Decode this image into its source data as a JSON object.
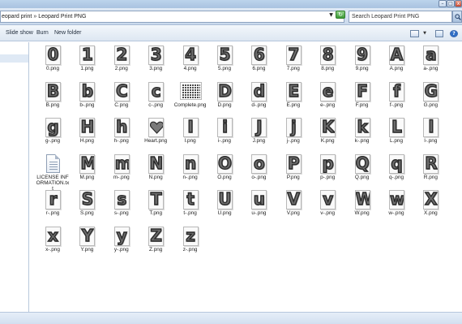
{
  "window": {
    "controls": {
      "minimize": "–",
      "maximize": "□",
      "close": "x"
    }
  },
  "address": {
    "crumbs": [
      "eopard print",
      "Leopard Print PNG"
    ],
    "separator": "»",
    "search_placeholder": "Search Leopard Print PNG"
  },
  "toolbar": {
    "slide_show": "Slide show",
    "burn": "Burn",
    "new_folder": "New folder"
  },
  "files": [
    {
      "name": "0.png",
      "glyph": "0"
    },
    {
      "name": "1.png",
      "glyph": "1"
    },
    {
      "name": "2.png",
      "glyph": "2"
    },
    {
      "name": "3.png",
      "glyph": "3"
    },
    {
      "name": "4.png",
      "glyph": "4"
    },
    {
      "name": "5.png",
      "glyph": "5"
    },
    {
      "name": "6.png",
      "glyph": "6"
    },
    {
      "name": "7.png",
      "glyph": "7"
    },
    {
      "name": "8.png",
      "glyph": "8"
    },
    {
      "name": "9.png",
      "glyph": "9"
    },
    {
      "name": "A.png",
      "glyph": "A"
    },
    {
      "name": "a-.png",
      "glyph": "a"
    },
    {
      "name": "B.png",
      "glyph": "B"
    },
    {
      "name": "b-.png",
      "glyph": "b"
    },
    {
      "name": "C.png",
      "glyph": "C"
    },
    {
      "name": "c-.png",
      "glyph": "c"
    },
    {
      "name": "Complete.png",
      "glyph": ""
    },
    {
      "name": "D.png",
      "glyph": "D"
    },
    {
      "name": "d-.png",
      "glyph": "d"
    },
    {
      "name": "E.png",
      "glyph": "E"
    },
    {
      "name": "e-.png",
      "glyph": "e"
    },
    {
      "name": "F.png",
      "glyph": "F"
    },
    {
      "name": "f-.png",
      "glyph": "f"
    },
    {
      "name": "G.png",
      "glyph": "G"
    },
    {
      "name": "g-.png",
      "glyph": "g"
    },
    {
      "name": "H.png",
      "glyph": "H"
    },
    {
      "name": "h-.png",
      "glyph": "h"
    },
    {
      "name": "Heart.png",
      "glyph": ""
    },
    {
      "name": "I.png",
      "glyph": "I"
    },
    {
      "name": "i-.png",
      "glyph": "i"
    },
    {
      "name": "J.png",
      "glyph": "J"
    },
    {
      "name": "j-.png",
      "glyph": "j"
    },
    {
      "name": "K.png",
      "glyph": "K"
    },
    {
      "name": "k-.png",
      "glyph": "k"
    },
    {
      "name": "L.png",
      "glyph": "L"
    },
    {
      "name": "l-.png",
      "glyph": "l"
    },
    {
      "name": "LICENSE INFORMATION.txt",
      "glyph": ""
    },
    {
      "name": "M.png",
      "glyph": "M"
    },
    {
      "name": "m-.png",
      "glyph": "m"
    },
    {
      "name": "N.png",
      "glyph": "N"
    },
    {
      "name": "n-.png",
      "glyph": "n"
    },
    {
      "name": "O.png",
      "glyph": "O"
    },
    {
      "name": "o-.png",
      "glyph": "o"
    },
    {
      "name": "P.png",
      "glyph": "P"
    },
    {
      "name": "p-.png",
      "glyph": "p"
    },
    {
      "name": "Q.png",
      "glyph": "Q"
    },
    {
      "name": "q-.png",
      "glyph": "q"
    },
    {
      "name": "R.png",
      "glyph": "R"
    },
    {
      "name": "r-.png",
      "glyph": "r"
    },
    {
      "name": "S.png",
      "glyph": "S"
    },
    {
      "name": "s-.png",
      "glyph": "s"
    },
    {
      "name": "T.png",
      "glyph": "T"
    },
    {
      "name": "t-.png",
      "glyph": "t"
    },
    {
      "name": "U.png",
      "glyph": "U"
    },
    {
      "name": "u-.png",
      "glyph": "u"
    },
    {
      "name": "V.png",
      "glyph": "V"
    },
    {
      "name": "v-.png",
      "glyph": "v"
    },
    {
      "name": "W.png",
      "glyph": "W"
    },
    {
      "name": "w-.png",
      "glyph": "w"
    },
    {
      "name": "X.png",
      "glyph": "X"
    },
    {
      "name": "x-.png",
      "glyph": "x"
    },
    {
      "name": "Y.png",
      "glyph": "Y"
    },
    {
      "name": "y-.png",
      "glyph": "y"
    },
    {
      "name": "Z.png",
      "glyph": "Z"
    },
    {
      "name": "z-.png",
      "glyph": "z"
    }
  ]
}
